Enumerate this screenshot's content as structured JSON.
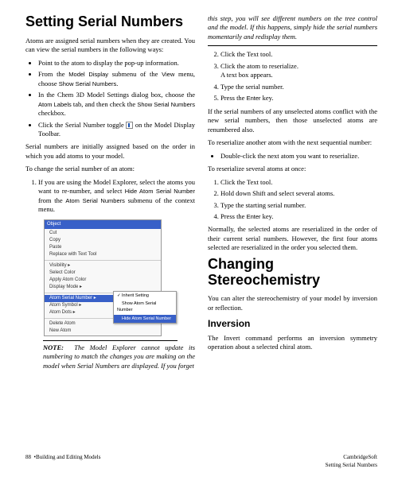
{
  "l": {
    "h1": "Setting Serial Numbers",
    "p1": "Atoms are assigned serial numbers when they are created. You can view the serial numbers in the following ways:",
    "b1": "Point to the atom to display the pop-up information.",
    "b2a": "From the ",
    "b2b": "Model Display",
    "b2c": " submenu of the ",
    "b2d": "View",
    "b2e": " menu, choose ",
    "b2f": "Show Serial Numbers",
    "b2g": ".",
    "b3a": "In the Chem 3D Model Settings dialog box, choose the ",
    "b3b": "Atom Labels",
    "b3c": " tab, and then check the ",
    "b3d": "Show Serial Numbers",
    "b3e": " checkbox.",
    "b4a": "Click the Serial Number toggle ",
    "b4b": " on the Model Display Toolbar.",
    "p2": "Serial numbers are initially assigned based on the order in which you add atoms to your model.",
    "p3": "To change the serial number of an atom:",
    "o1a": "If you are using the Model Explorer, select the atoms you want to re-number, and select ",
    "o1b": "Hide Atom Serial Number",
    "o1c": " from the ",
    "o1d": "Atom Serial Numbers",
    "o1e": " submenu of the context menu.",
    "menu": {
      "hdr": "Object",
      "items": [
        "Cut",
        "Copy",
        "Paste",
        "Replace with Text Tool"
      ],
      "items2": [
        "Visibility",
        "Select Color",
        "Apply Atom Color",
        "Display Mode"
      ],
      "anchor": "Atom Serial Number",
      "sub": [
        "Inherit Setting",
        "Show Atom Serial Number",
        "Hide Atom Serial Number"
      ],
      "items3": [
        "Atom Symbol",
        "Atom Dots"
      ],
      "items4": [
        "Delete Atom",
        "New Atom"
      ]
    },
    "note_label": "NOTE:",
    "note": "The Model Explorer cannot update its numbering to match the changes you are making on the model when Serial Numbers are displayed. If you forget"
  },
  "r": {
    "cont": "this step, you will see different numbers on the tree control and the model. If this happens, simply hide the serial numbers momentarily and redisplay them.",
    "s2a": "Click the Text tool.",
    "s3a": "Click the atom to reserialize.",
    "s3b": "A text box appears.",
    "s4a": "Type the serial number.",
    "s5a": "Press the ",
    "s5b": "Enter",
    "s5c": " key.",
    "p1": "If the serial numbers of any unselected atoms conflict with the new serial numbers, then those unselected atoms are renumbered also.",
    "p2": "To reserialize another atom with the next sequential number:",
    "b1": "Double-click the next atom you want to reserialize.",
    "p3": "To reserialize several atoms at once:",
    "o1": "Click the Text tool.",
    "o2": "Hold down Shift and select several atoms.",
    "o3": "Type the starting serial number.",
    "o4a": "Press the ",
    "o4b": "Enter",
    "o4c": " key.",
    "p4": "Normally, the selected atoms are reserialized in the order of their current serial numbers. However, the first four atoms selected are reserialized in the order you selected them.",
    "h1": "Changing Stereochemistry",
    "p5": "You can alter the stereochemistry of your model by inversion or reflection.",
    "h2": "Inversion",
    "p6": "The Invert command performs an inversion symmetry operation about a selected chiral atom."
  },
  "f": {
    "l1": "88",
    "l2": "•Building and Editing Models",
    "r1": "CambridgeSoft",
    "r2": "Setting Serial Numbers"
  }
}
